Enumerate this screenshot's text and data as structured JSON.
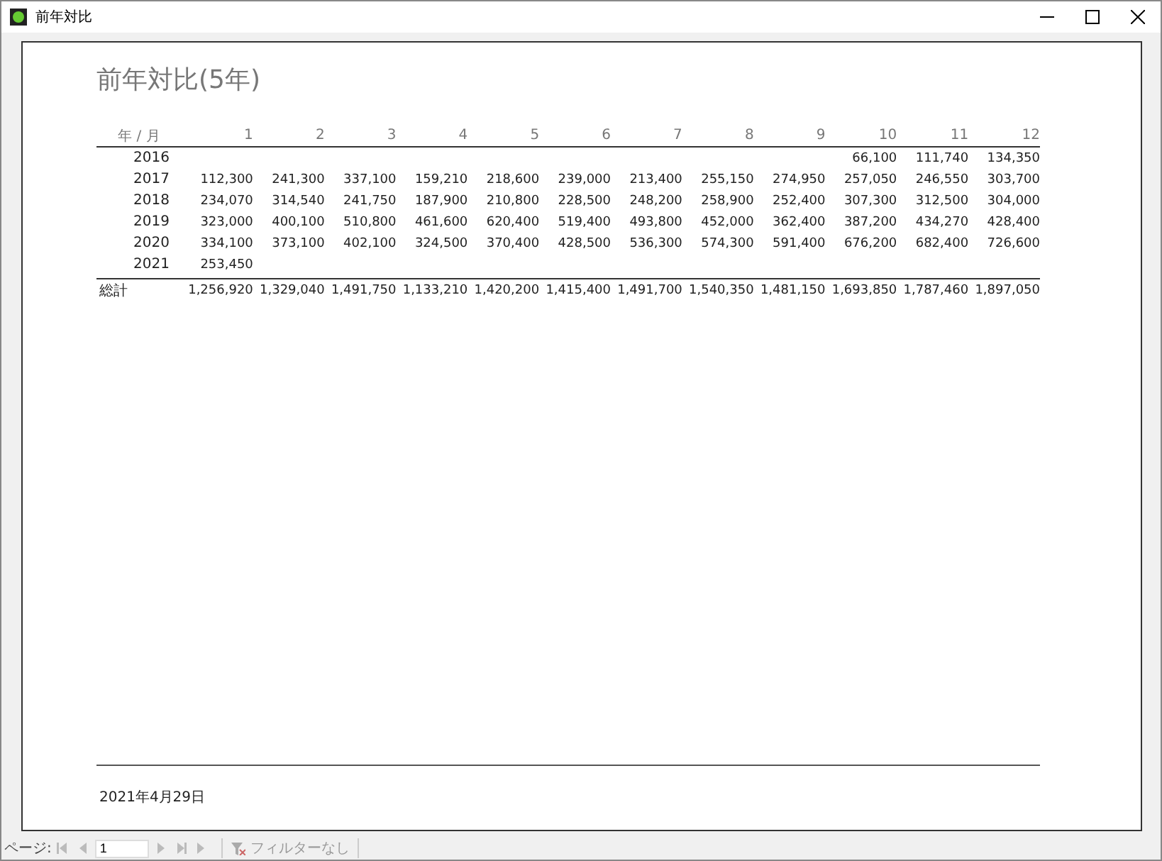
{
  "window": {
    "title": "前年対比"
  },
  "report": {
    "title": "前年対比(5年)",
    "table": {
      "columns": [
        "年 / 月",
        "1",
        "2",
        "3",
        "4",
        "5",
        "6",
        "7",
        "8",
        "9",
        "10",
        "11",
        "12"
      ],
      "rows": [
        {
          "year": "2016",
          "cells": {
            "m10": "66,100",
            "m11": "111,740",
            "m12": "134,350"
          }
        },
        {
          "year": "2017",
          "cells": {
            "m1": "112,300",
            "m2": "241,300",
            "m3": "337,100",
            "m4": "159,210",
            "m5": "218,600",
            "m6": "239,000",
            "m7": "213,400",
            "m8": "255,150",
            "m9": "274,950",
            "m10": "257,050",
            "m11": "246,550",
            "m12": "303,700"
          }
        },
        {
          "year": "2018",
          "cells": {
            "m1": "234,070",
            "m2": "314,540",
            "m3": "241,750",
            "m4": "187,900",
            "m5": "210,800",
            "m6": "228,500",
            "m7": "248,200",
            "m8": "258,900",
            "m9": "252,400",
            "m10": "307,300",
            "m11": "312,500",
            "m12": "304,000"
          }
        },
        {
          "year": "2019",
          "cells": {
            "m1": "323,000",
            "m2": "400,100",
            "m3": "510,800",
            "m4": "461,600",
            "m5": "620,400",
            "m6": "519,400",
            "m7": "493,800",
            "m8": "452,000",
            "m9": "362,400",
            "m10": "387,200",
            "m11": "434,270",
            "m12": "428,400"
          }
        },
        {
          "year": "2020",
          "cells": {
            "m1": "334,100",
            "m2": "373,100",
            "m3": "402,100",
            "m4": "324,500",
            "m5": "370,400",
            "m6": "428,500",
            "m7": "536,300",
            "m8": "574,300",
            "m9": "591,400",
            "m10": "676,200",
            "m11": "682,400",
            "m12": "726,600"
          }
        },
        {
          "year": "2021",
          "cells": {
            "m1": "253,450"
          }
        }
      ],
      "total": {
        "label": "総計",
        "values": [
          "1,256,920",
          "1,329,040",
          "1,491,750",
          "1,133,210",
          "1,420,200",
          "1,415,400",
          "1,491,700",
          "1,540,350",
          "1,481,150",
          "1,693,850",
          "1,787,460",
          "1,897,050"
        ]
      }
    },
    "date": "2021年4月29日"
  },
  "navigation": {
    "label": "ページ:",
    "page": "1",
    "filter": "フィルターなし"
  }
}
